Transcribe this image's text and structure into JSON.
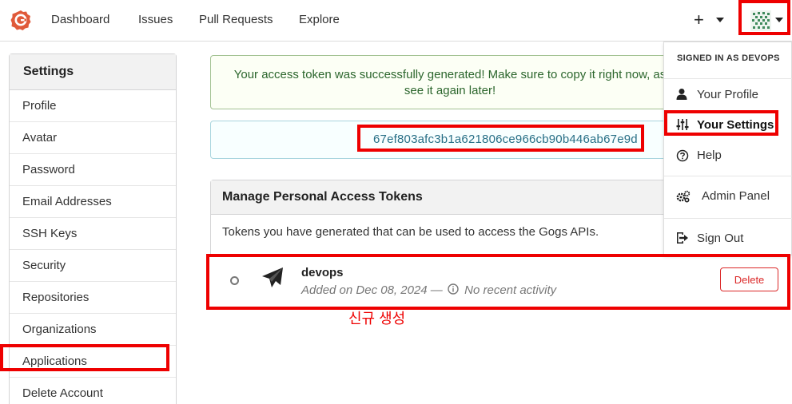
{
  "navbar": {
    "links": [
      "Dashboard",
      "Issues",
      "Pull Requests",
      "Explore"
    ],
    "plus": "+"
  },
  "sidebar": {
    "title": "Settings",
    "items": [
      "Profile",
      "Avatar",
      "Password",
      "Email Addresses",
      "SSH Keys",
      "Security",
      "Repositories",
      "Organizations",
      "Applications",
      "Delete Account"
    ]
  },
  "main": {
    "success_message": "Your access token was successfully generated! Make sure to copy it right now, as you won't be able to see it again later!",
    "success_line1": "Your access token was successfully generated! Make sure to copy it right now, as",
    "success_line2": "see it again later!",
    "token_value": "67ef803afc3b1a621806ce966cb90b446ab67e9d",
    "panel_title": "Manage Personal Access Tokens",
    "panel_description": "Tokens you have generated that can be used to access the Gogs APIs.",
    "token": {
      "name": "devops",
      "added_on": "Added on Dec 08, 2024 —",
      "activity": "No recent activity",
      "delete_label": "Delete"
    },
    "annotation": "신규 생성"
  },
  "dropdown": {
    "header": "SIGNED IN AS DEVOPS",
    "items": [
      "Your Profile",
      "Your Settings",
      "Help",
      "Admin Panel",
      "Sign Out"
    ]
  },
  "colors": {
    "success_bg": "#fcfff5",
    "success_text": "#2c662d",
    "token_text": "#276f86",
    "danger": "#db2828",
    "annotation_red": "#e00000",
    "logo": "#e05a3a"
  }
}
